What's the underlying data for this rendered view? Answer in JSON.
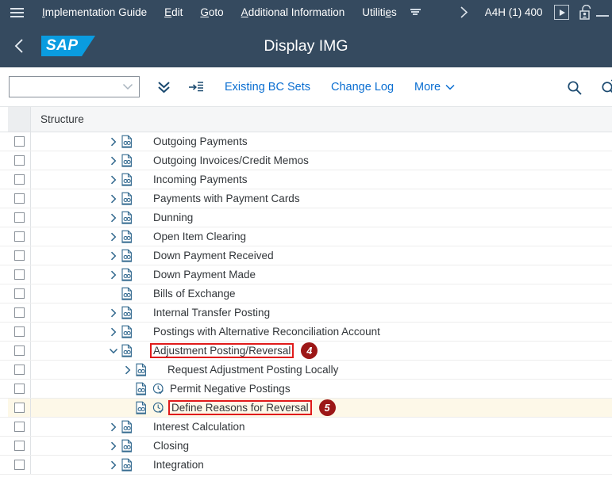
{
  "menubar": {
    "hamburger_icon": "hamburger-icon",
    "items": [
      {
        "label": "Implementation Guide",
        "underline_index": 0
      },
      {
        "label": "Edit",
        "underline_index": 0
      },
      {
        "label": "Goto",
        "underline_index": 0
      },
      {
        "label": "Additional Information",
        "underline_index": 0
      },
      {
        "label": "Utilities",
        "underline_index": 7
      }
    ],
    "more_icon": "menu-more-icon",
    "forward_icon": "chevron-right-icon",
    "system_id": "A4H (1) 400",
    "execute_icon": "execute-play-icon",
    "lock_icon": "unlocked-user-icon",
    "minimize_icon": "minimize-icon"
  },
  "shellbar": {
    "back_icon": "back-chevron-icon",
    "logo_text": "SAP",
    "title": "Display IMG"
  },
  "toolbar": {
    "combo_value": "",
    "combo_placeholder": "",
    "combo_icon": "chevron-down-icon",
    "expand_all_icon": "expand-all-double-chevron-icon",
    "collapse_icon": "arrow-to-list-icon",
    "links": [
      {
        "label": "Existing BC Sets",
        "has_chevron": false
      },
      {
        "label": "Change Log",
        "has_chevron": false
      },
      {
        "label": "More",
        "has_chevron": true
      }
    ],
    "search_icon": "search-icon",
    "search_next_icon": "search-next-icon"
  },
  "table": {
    "column_header": "Structure",
    "rows": [
      {
        "label": "Outgoing Payments",
        "indent": 0,
        "twisty": "collapsed",
        "doc": true,
        "clock": false,
        "boxed": false,
        "badge": null,
        "selected": false
      },
      {
        "label": "Outgoing Invoices/Credit Memos",
        "indent": 0,
        "twisty": "collapsed",
        "doc": true,
        "clock": false,
        "boxed": false,
        "badge": null,
        "selected": false
      },
      {
        "label": "Incoming Payments",
        "indent": 0,
        "twisty": "collapsed",
        "doc": true,
        "clock": false,
        "boxed": false,
        "badge": null,
        "selected": false
      },
      {
        "label": "Payments with Payment Cards",
        "indent": 0,
        "twisty": "collapsed",
        "doc": true,
        "clock": false,
        "boxed": false,
        "badge": null,
        "selected": false
      },
      {
        "label": "Dunning",
        "indent": 0,
        "twisty": "collapsed",
        "doc": true,
        "clock": false,
        "boxed": false,
        "badge": null,
        "selected": false
      },
      {
        "label": "Open Item Clearing",
        "indent": 0,
        "twisty": "collapsed",
        "doc": true,
        "clock": false,
        "boxed": false,
        "badge": null,
        "selected": false
      },
      {
        "label": "Down Payment Received",
        "indent": 0,
        "twisty": "collapsed",
        "doc": true,
        "clock": false,
        "boxed": false,
        "badge": null,
        "selected": false
      },
      {
        "label": "Down Payment Made",
        "indent": 0,
        "twisty": "collapsed",
        "doc": true,
        "clock": false,
        "boxed": false,
        "badge": null,
        "selected": false
      },
      {
        "label": "Bills of Exchange",
        "indent": 0,
        "twisty": "none",
        "doc": true,
        "clock": false,
        "boxed": false,
        "badge": null,
        "selected": false
      },
      {
        "label": "Internal Transfer Posting",
        "indent": 0,
        "twisty": "collapsed",
        "doc": true,
        "clock": false,
        "boxed": false,
        "badge": null,
        "selected": false
      },
      {
        "label": "Postings with Alternative Reconciliation Account",
        "indent": 0,
        "twisty": "collapsed",
        "doc": true,
        "clock": false,
        "boxed": false,
        "badge": null,
        "selected": false
      },
      {
        "label": "Adjustment Posting/Reversal",
        "indent": 0,
        "twisty": "expanded",
        "doc": true,
        "clock": false,
        "boxed": true,
        "badge": "4",
        "selected": false
      },
      {
        "label": "Request Adjustment Posting Locally",
        "indent": 1,
        "twisty": "collapsed",
        "doc": true,
        "clock": false,
        "boxed": false,
        "badge": null,
        "selected": false
      },
      {
        "label": "Permit Negative Postings",
        "indent": 1,
        "twisty": "none",
        "doc": true,
        "clock": true,
        "boxed": false,
        "badge": null,
        "selected": false
      },
      {
        "label": "Define Reasons for Reversal",
        "indent": 1,
        "twisty": "none",
        "doc": true,
        "clock": true,
        "boxed": true,
        "badge": "5",
        "selected": true
      },
      {
        "label": "Interest Calculation",
        "indent": 0,
        "twisty": "collapsed",
        "doc": true,
        "clock": false,
        "boxed": false,
        "badge": null,
        "selected": false
      },
      {
        "label": "Closing",
        "indent": 0,
        "twisty": "collapsed",
        "doc": true,
        "clock": false,
        "boxed": false,
        "badge": null,
        "selected": false
      },
      {
        "label": "Integration",
        "indent": 0,
        "twisty": "collapsed",
        "doc": true,
        "clock": false,
        "boxed": false,
        "badge": null,
        "selected": false
      }
    ]
  },
  "colors": {
    "shell_bg": "#354a5f",
    "logo_blue": "#0a9ce0",
    "link_blue": "#0a6ed1",
    "annotation_red": "#e01b1b",
    "badge_red": "#9c1717",
    "selected_row": "#fdf8e8"
  }
}
